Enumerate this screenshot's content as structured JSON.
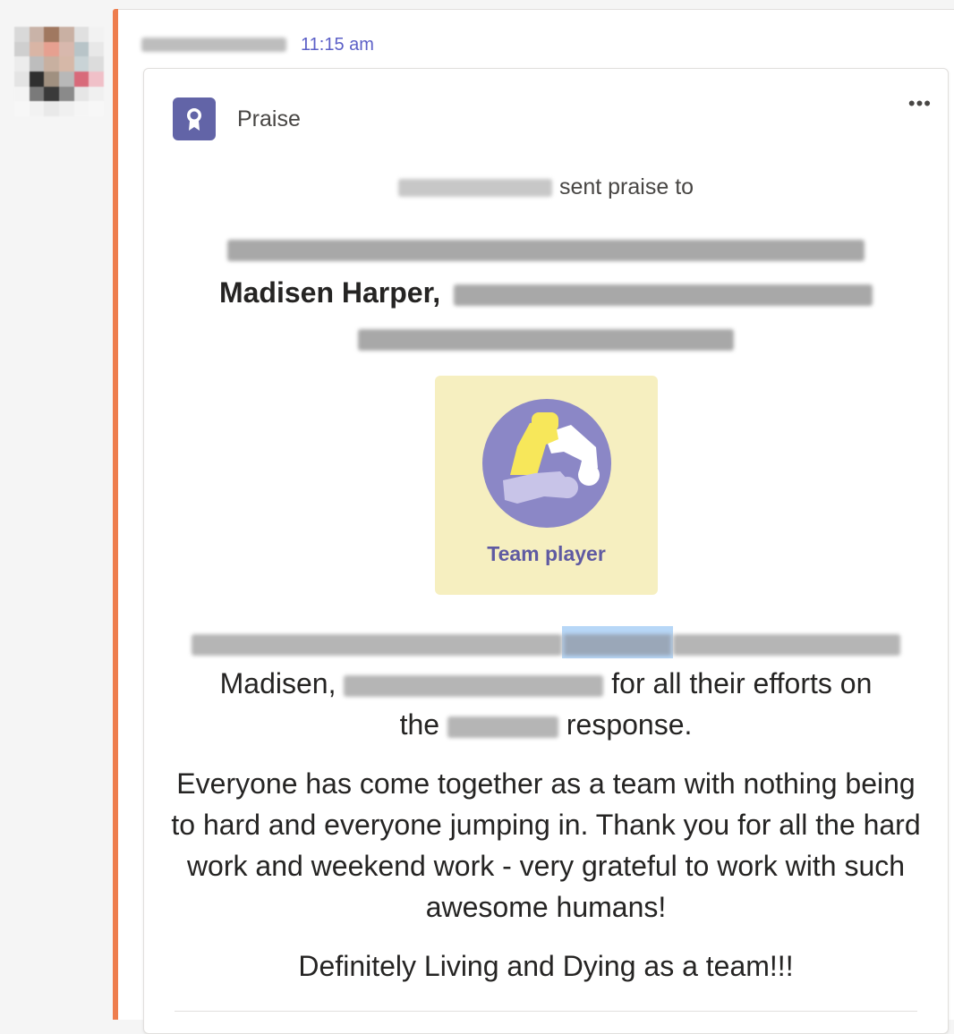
{
  "message": {
    "timestamp": "11:15 am"
  },
  "card": {
    "title": "Praise",
    "more_label": "•••",
    "sent_text": "sent praise to",
    "recipient_named": "Madisen Harper,",
    "badge_label": "Team player",
    "body_line2_name": "Madisen,",
    "body_line2_end": "for all their efforts on",
    "body_line3_start": "the",
    "body_line3_end": "response.",
    "paragraph2": "Everyone has come together as a team with nothing being to hard and everyone jumping in. Thank you for all the hard work and weekend work - very grateful to work with such awesome humans!",
    "paragraph3": "Definitely Living and Dying as a team!!!"
  },
  "icons": {
    "praise": "ribbon-badge-icon",
    "more": "more-options-icon",
    "badge_art": "team-player-arms-icon"
  },
  "colors": {
    "accent_bar": "#ee7d4d",
    "timestamp": "#5b5fc7",
    "praise_icon_bg": "#6264a7",
    "badge_bg": "#f6efc0",
    "badge_circle": "#8b87c6",
    "badge_text": "#5f5aa2"
  }
}
